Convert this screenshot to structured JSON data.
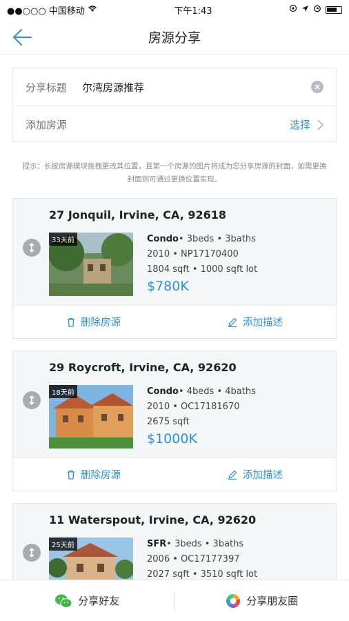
{
  "status_bar": {
    "carrier": "●●○○○ 中国移动",
    "time": "下午1:43"
  },
  "nav": {
    "title": "房源分享"
  },
  "form": {
    "title_label": "分享标题",
    "title_value": "尔湾房源推荐",
    "add_label": "添加房源",
    "select_label": "选择"
  },
  "hint": "提示：长按房源模块拖拽更改其位置，且第一个房源的图片将成为您分享房源的封面，如需更换封面则可通过更换位置实现。",
  "listings": [
    {
      "address": "27  Jonquil, Irvine, CA, 92618",
      "days": "33天前",
      "type": "Condo",
      "beds_baths": "• 3beds • 3baths",
      "year_mls": "2010 • NP17170400",
      "size": "1804 sqft • 1000 sqft lot",
      "price": "$780K",
      "delete_label": "删除房源",
      "describe_label": "添加描述"
    },
    {
      "address": "29  Roycroft, Irvine, CA, 92620",
      "days": "18天前",
      "type": "Condo",
      "beds_baths": "• 4beds • 4baths",
      "year_mls": "2010 • OC17181670",
      "size": "2675 sqft",
      "price": "$1000K",
      "delete_label": "删除房源",
      "describe_label": "添加描述"
    },
    {
      "address": "11  Waterspout, Irvine, CA, 92620",
      "days": "25天前",
      "type": "SFR",
      "beds_baths": "• 3beds • 3baths",
      "year_mls": "2006 • OC17177397",
      "size": "2027 sqft • 3510 sqft lot"
    }
  ],
  "bottom_bar": {
    "share_friends": "分享好友",
    "share_moments": "分享朋友圈"
  },
  "colors": {
    "accent": "#2f8fd7",
    "wechat_green": "#44b549"
  },
  "icons": [
    "wifi-icon",
    "location-icon",
    "alarm-icon",
    "battery-icon",
    "back-arrow-icon",
    "clear-icon",
    "chevron-right-icon",
    "drag-handle-icon",
    "trash-icon",
    "pencil-icon",
    "wechat-icon",
    "moments-icon"
  ]
}
